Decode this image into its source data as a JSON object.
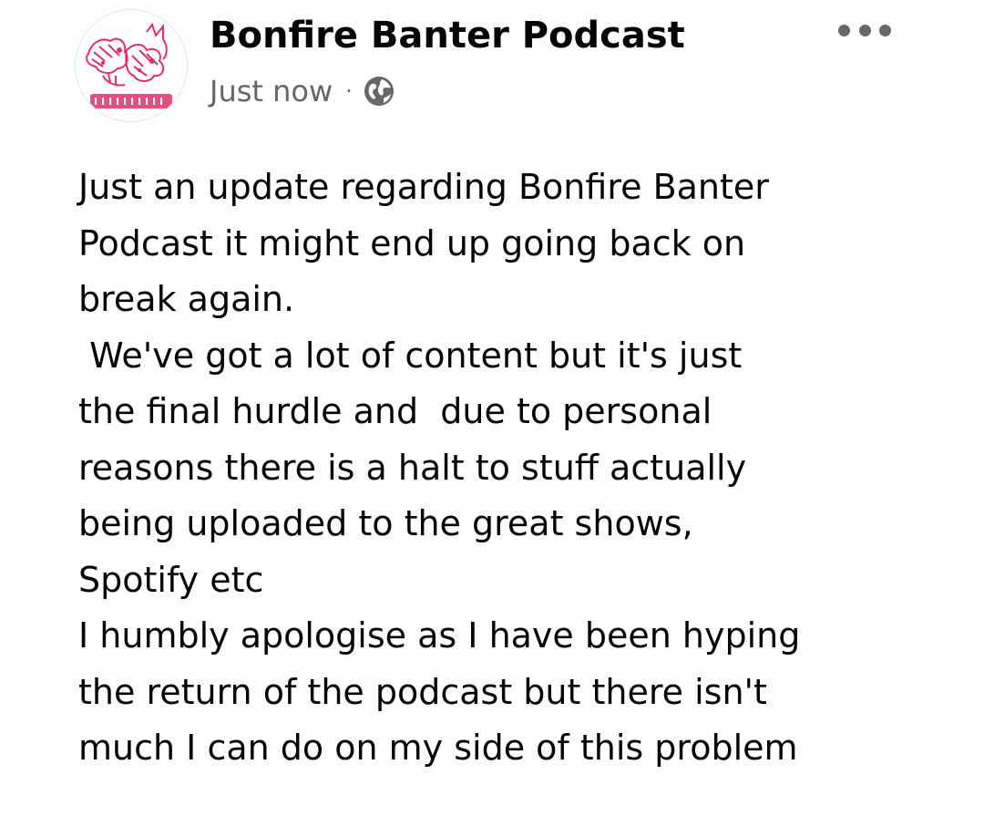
{
  "post": {
    "author": "Bonfire Banter Podcast",
    "timestamp": "Just now",
    "separator": "·",
    "audience_icon": "globe-icon",
    "menu_icon": "more-options-icon",
    "body_lines": [
      "Just an update regarding Bonfire Banter",
      "Podcast it might end up going back on",
      "break again.",
      " We've got a lot of content but it's just",
      "the final hurdle and  due to personal",
      "reasons there is a halt to stuff actually",
      "being uploaded to the great shows,",
      "Spotify etc",
      "I humbly apologise as I have been hyping",
      "the return of the podcast but there isn't",
      "much I can do on my side of this problem"
    ]
  },
  "colors": {
    "text_primary": "#050505",
    "text_secondary": "#65676b",
    "avatar_ink": "#e0306a"
  }
}
